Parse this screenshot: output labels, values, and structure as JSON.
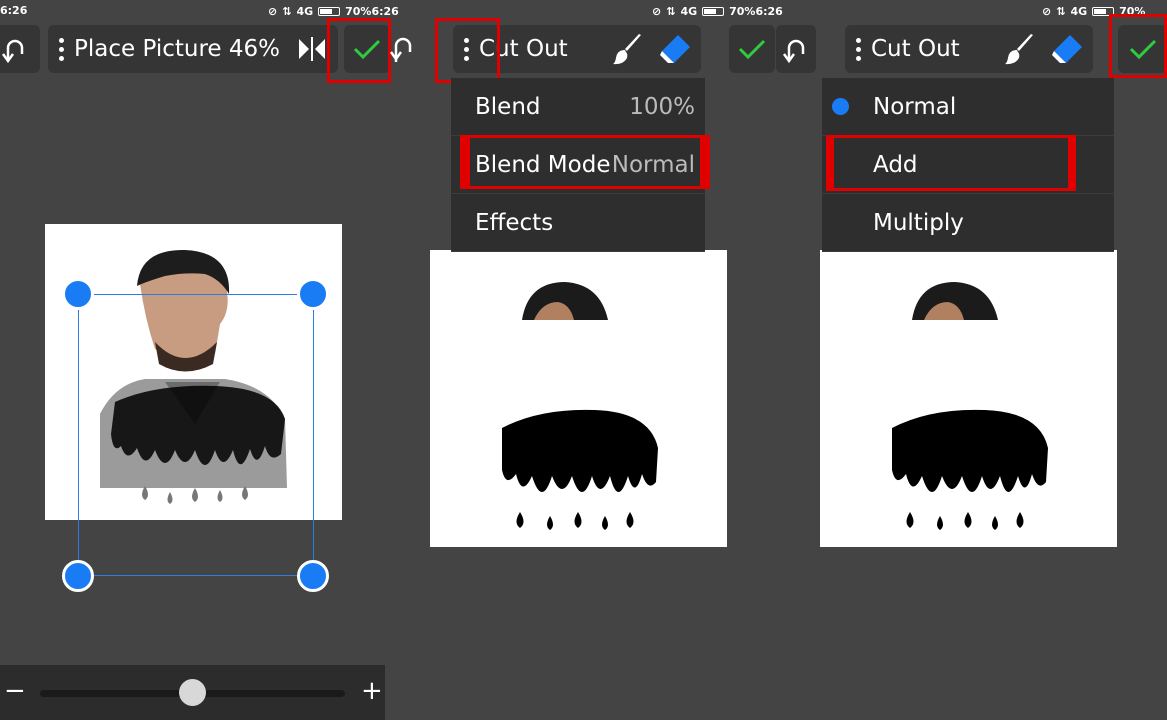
{
  "status": {
    "time_left": "6:26",
    "time_mid1": "70%6:26",
    "time_mid2": "70%6:26",
    "network": "4G",
    "battery_right": "70%"
  },
  "panel1": {
    "toolbar_label": "Place Picture 46%",
    "flip_icon": "flip-horizontal-icon",
    "confirm_icon": "checkmark-icon",
    "undo_icon": "undo-icon",
    "slider": {
      "minus": "−",
      "plus": "+",
      "value": 0.5
    }
  },
  "panel2": {
    "toolbar_label": "Cut Out",
    "menu": [
      {
        "label": "Blend",
        "value": "100%"
      },
      {
        "label": "Blend Mode",
        "value": "Normal"
      },
      {
        "label": "Effects",
        "value": ""
      }
    ]
  },
  "panel3": {
    "toolbar_label": "Cut Out",
    "menu": [
      {
        "label": "Normal",
        "selected": true
      },
      {
        "label": "Add",
        "selected": false
      },
      {
        "label": "Multiply",
        "selected": false
      }
    ]
  },
  "colors": {
    "accent": "#1a7cf5",
    "confirm": "#2ecc40",
    "highlight": "#e00000",
    "background": "#444444"
  }
}
